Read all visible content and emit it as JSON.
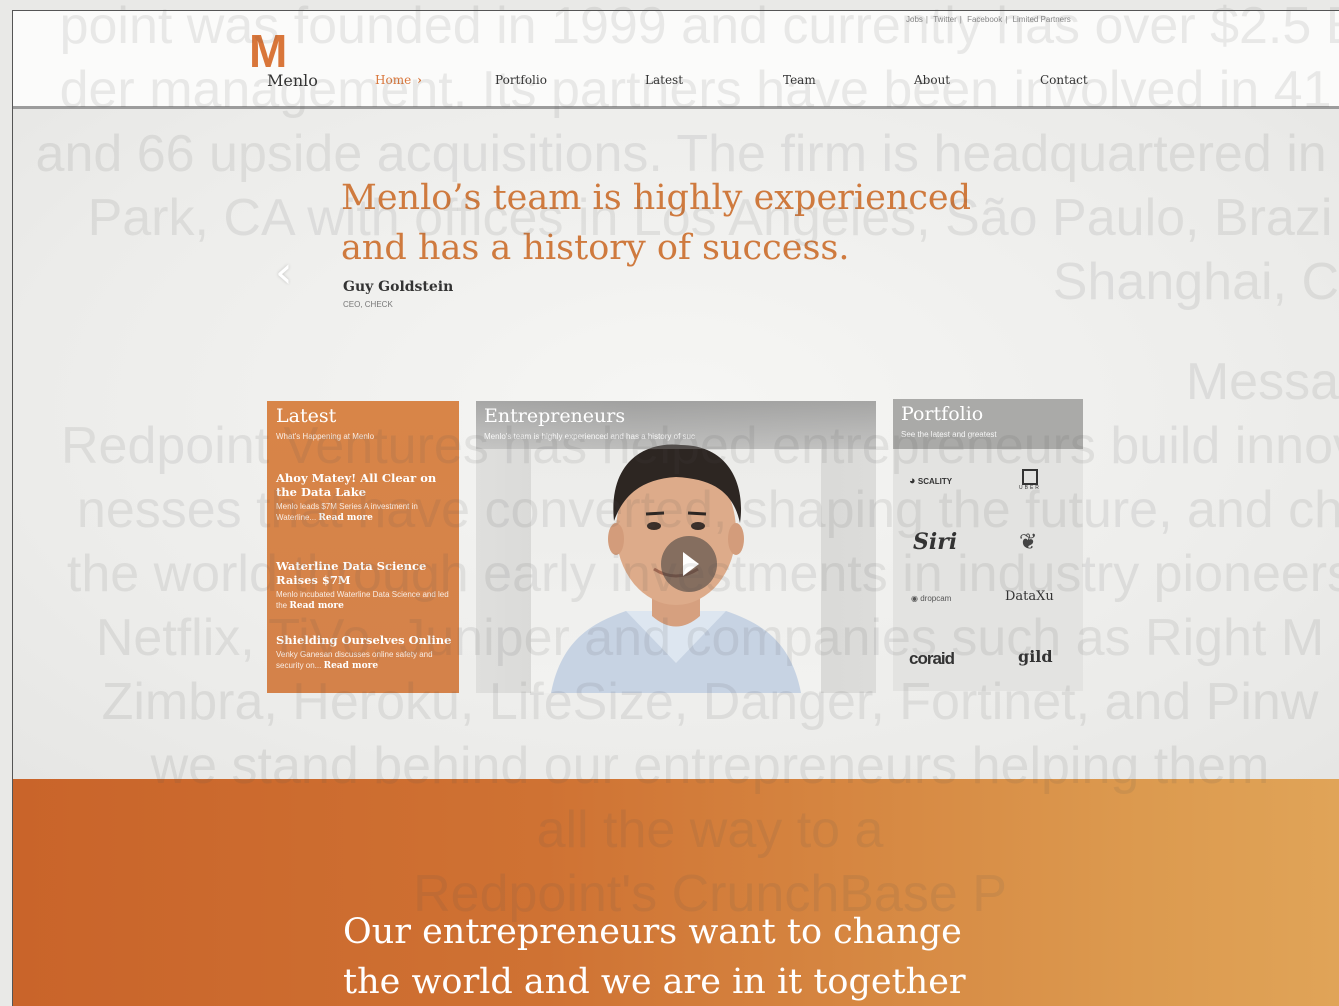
{
  "header": {
    "top_links": [
      "Jobs",
      "Twitter",
      "Facebook",
      "Limited Partners"
    ],
    "logo_mark": "M",
    "logo_word": "Menlo",
    "nav": [
      {
        "label": "Home",
        "active": true
      },
      {
        "label": "Portfolio"
      },
      {
        "label": "Latest"
      },
      {
        "label": "Team"
      },
      {
        "label": "About"
      },
      {
        "label": "Contact"
      }
    ]
  },
  "hero": {
    "quote_line1": "Menlo’s team is highly experienced",
    "quote_line2": "and has a history of success.",
    "author": "Guy Goldstein",
    "author_title": "CEO, CHECK",
    "prev_glyph": "‹"
  },
  "latest": {
    "title": "Latest",
    "subtitle": "What's Happening at Menlo",
    "items": [
      {
        "title": "Ahoy Matey! All Clear on the Data Lake",
        "desc": "Menlo leads $7M Series A investment in Waterline...",
        "more": "Read more"
      },
      {
        "title": "Waterline Data Science Raises $7M",
        "desc": "Menlo incubated Waterline Data Science and led the",
        "more": "Read more"
      },
      {
        "title": "Shielding Ourselves Online",
        "desc": "Venky Ganesan discusses online safety and security on...",
        "more": "Read more"
      }
    ]
  },
  "entrepreneurs": {
    "title": "Entrepreneurs",
    "subtitle": "Menlo's team is highly experienced and has a history of suc"
  },
  "portfolio": {
    "title": "Portfolio",
    "subtitle": "See the latest and greatest",
    "logos": [
      "SCALITY",
      "UBER",
      "Siri",
      "",
      "dropcam",
      "DataXu",
      "coraid",
      "gild"
    ]
  },
  "band": {
    "line1": "Our entrepreneurs want to change",
    "line2": "the world and we are in it together"
  },
  "background_text": {
    "lines": [
      "point was founded in 1999 and currently has over $2.5 B",
      "der management. Its partners have been involved in 41 I",
      "and 66 upside acquisitions. The firm is headquartered in M",
      "Park, CA with offices in Los Angeles, São Paulo, Brazi",
      "Shanghai, C",
      "Messa",
      "Redpoint Ventures has helped entrepreneurs build innov",
      "nesses that have converted, shaping the future, and ch",
      "the world through early investments in industry pioneers",
      "Netflix, TiVo, Juniper and companies such as Right M",
      "Zimbra, Heroku, LifeSize, Danger, Fortinet, and Pinw",
      "we stand behind our entrepreneurs helping them",
      "all the way to a",
      "Redpoint's CrunchBase P"
    ]
  },
  "colors": {
    "accent": "#d9763a",
    "latest_panel": "#d88548",
    "band_start": "#c9642a",
    "band_end": "#e0a458"
  }
}
